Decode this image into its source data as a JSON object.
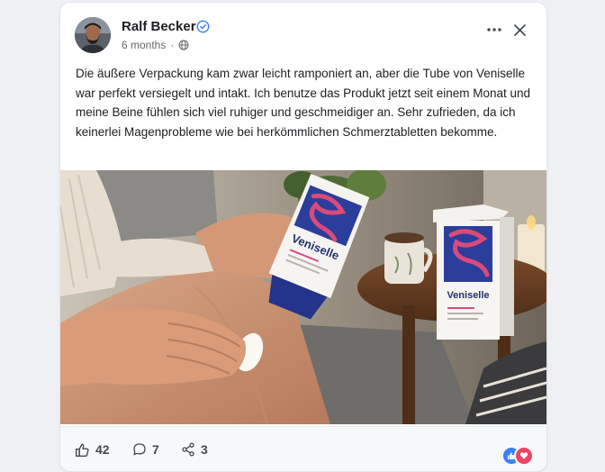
{
  "post": {
    "author_name": "Ralf Becker",
    "timestamp": "6 months",
    "separator": "·",
    "visibility_icon": "globe-icon",
    "verified_icon": "verified-badge-icon",
    "text": "Die äußere Verpackung kam zwar leicht ramponiert an, aber die Tube von Veniselle war perfekt versiegelt und intakt. Ich benutze das Produkt jetzt seit einem Monat und meine Beine fühlen sich viel ruhiger und geschmeidiger an. Sehr zufrieden, da ich keinerlei Magenprobleme wie bei herkömmlichen Schmerztabletten bekomme."
  },
  "photo": {
    "tube_brand": "Veniselle",
    "box_brand": "Veniselle"
  },
  "stats": {
    "likes": "42",
    "comments": "7",
    "shares": "3"
  },
  "reactions": [
    "like",
    "love"
  ],
  "colors": {
    "accent": "#3b82f6",
    "love": "#ef4463",
    "text": "#1c1e21",
    "muted": "#65676b",
    "product_blue": "#2c3e9c",
    "product_pink": "#d94b7a"
  }
}
